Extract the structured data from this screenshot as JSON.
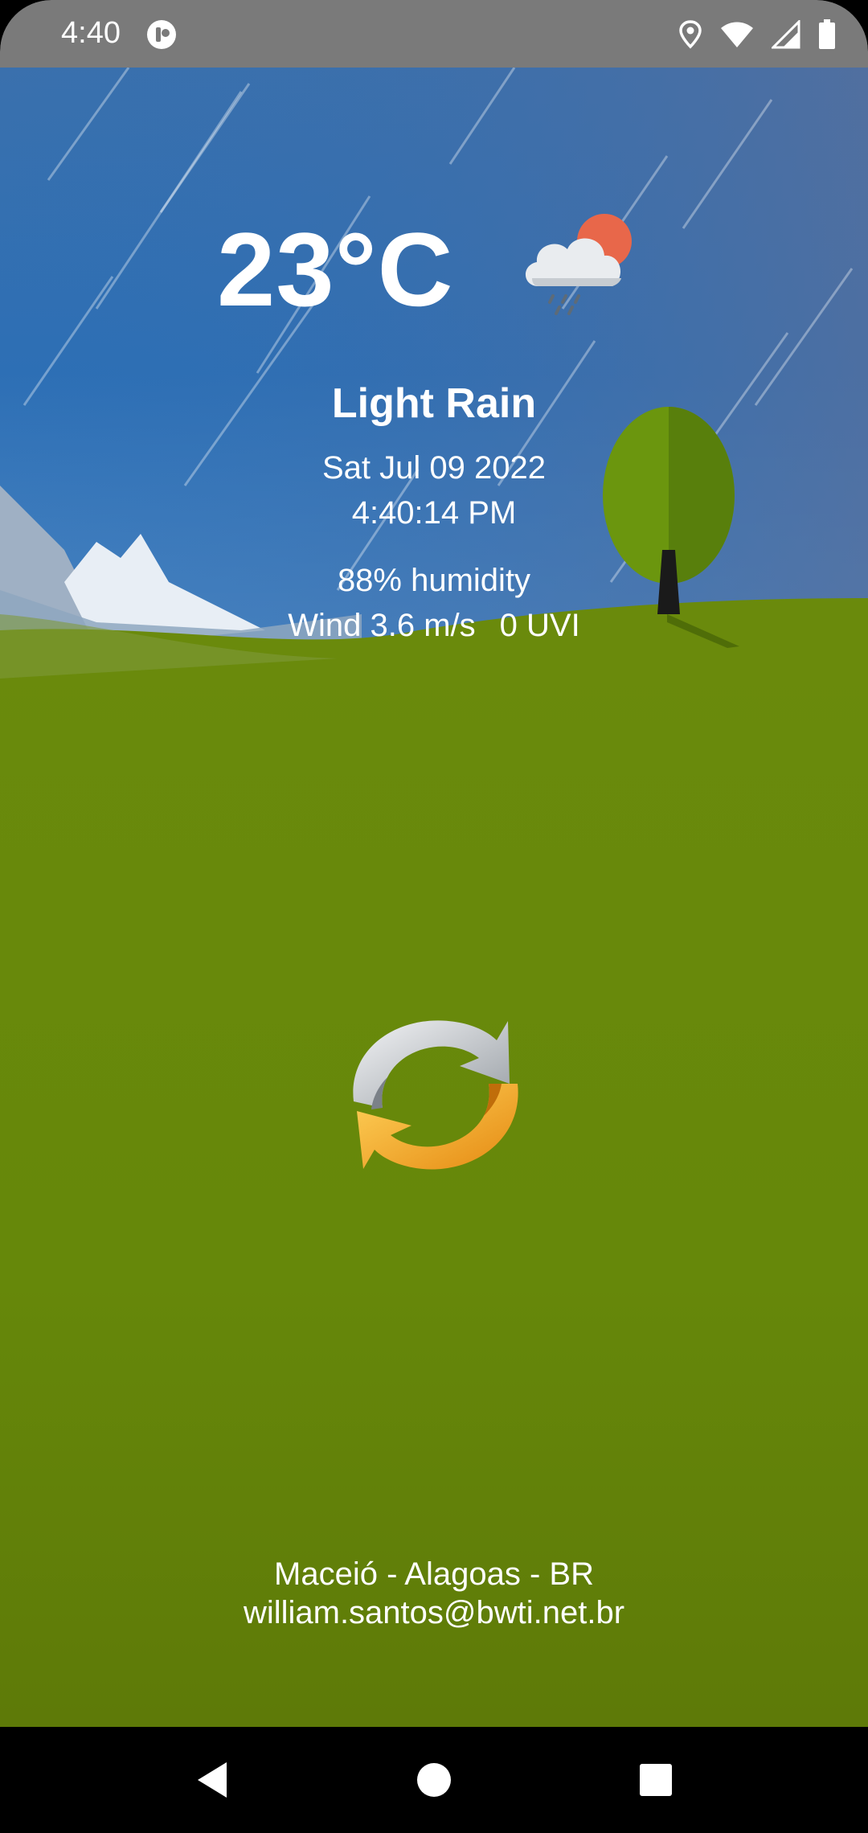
{
  "status_bar": {
    "time": "4:40",
    "left_icon": "app-notification-icon",
    "right_icons": [
      "location-icon",
      "wifi-icon",
      "cell-signal-icon",
      "battery-icon"
    ]
  },
  "weather": {
    "temperature": "23°C",
    "icon": "cloud-sun-rain-icon",
    "condition": "Light Rain",
    "date": "Sat Jul 09 2022",
    "time": "4:40:14 PM",
    "humidity": "88% humidity",
    "wind": "Wind 3.6 m/s",
    "uvi": "0 UVI"
  },
  "refresh": {
    "icon": "refresh-icon"
  },
  "footer": {
    "location": "Maceió - Alagoas - BR",
    "email": "william.santos@bwti.net.br"
  },
  "nav_bar": {
    "icons": [
      "back-icon",
      "home-icon",
      "recent-apps-icon"
    ]
  },
  "colors": {
    "sky_top": "#2e6fb0",
    "grass": "#67880a",
    "status_bar": "#7a7a7a",
    "text": "#ffffff",
    "refresh_gray": "#c9cdd2",
    "refresh_orange": "#f5a623"
  }
}
